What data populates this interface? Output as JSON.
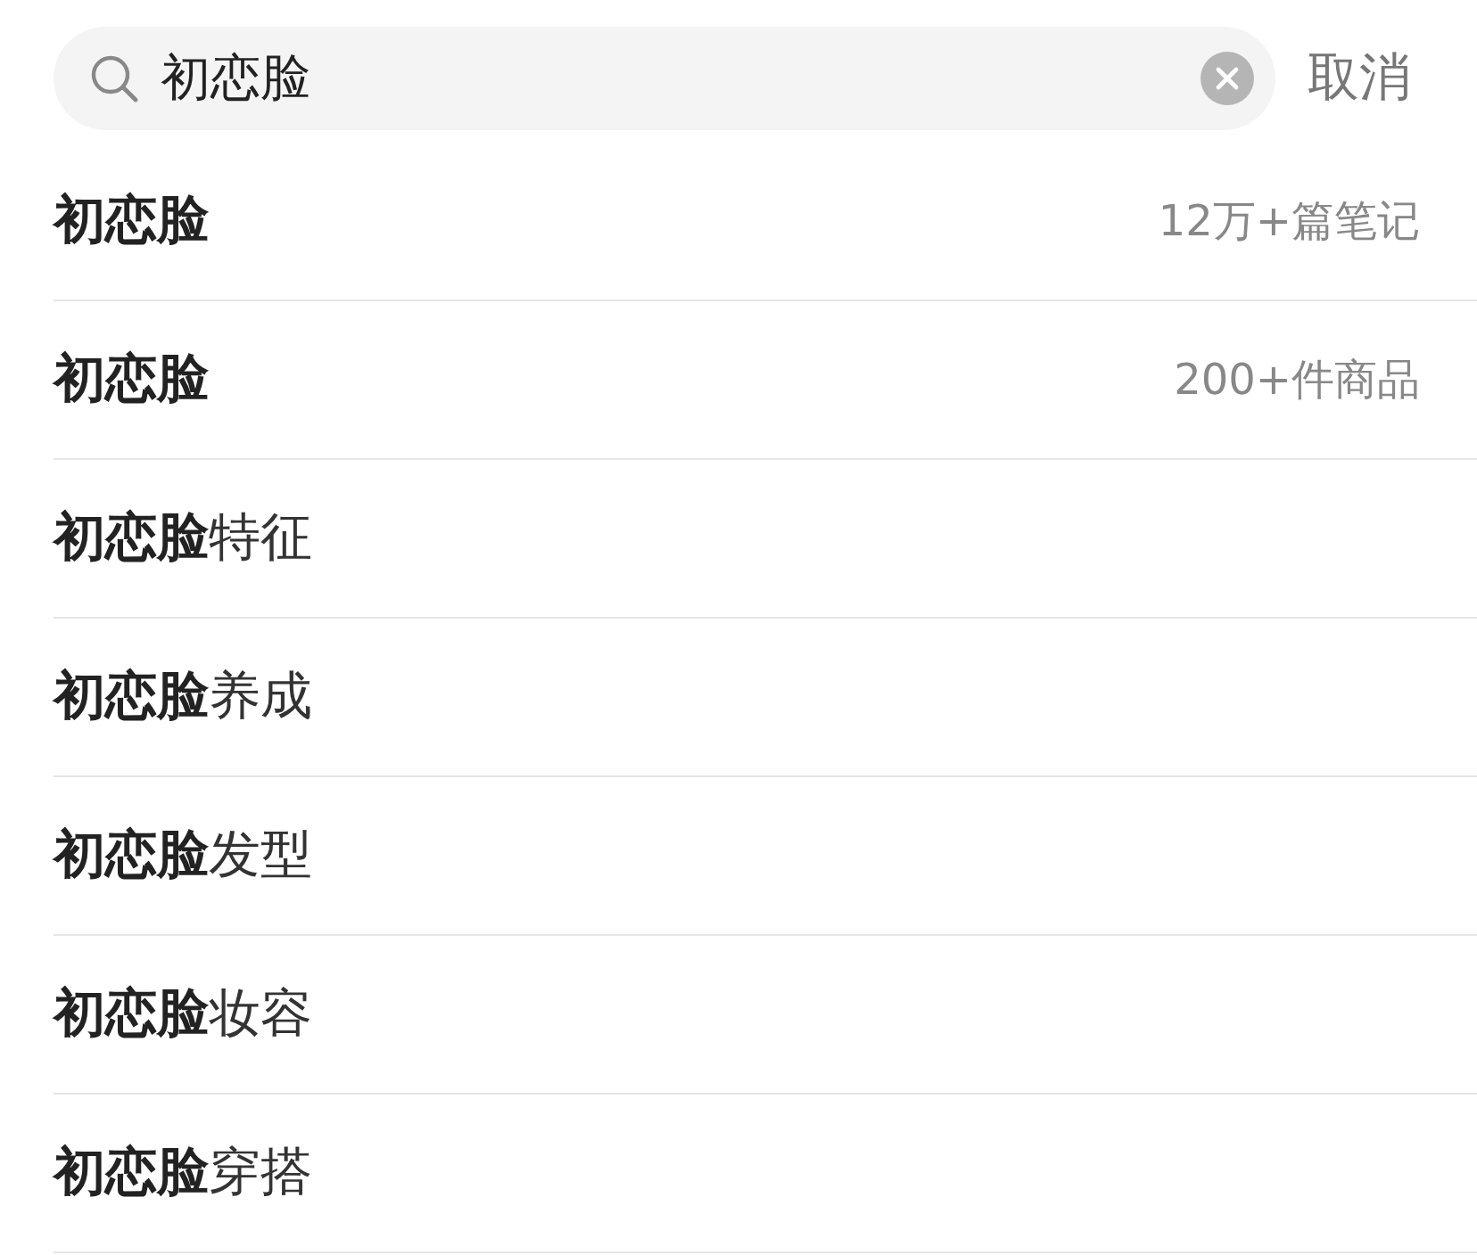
{
  "search": {
    "value": "初恋脸",
    "cancel": "取消"
  },
  "suggestions": [
    {
      "kind": "match",
      "text": "初恋脸",
      "count": "12万+篇笔记"
    },
    {
      "kind": "match",
      "text": "初恋脸",
      "count": "200+件商品"
    },
    {
      "kind": "completion",
      "text": "**初恋脸**特征"
    },
    {
      "kind": "completion",
      "text": "**初恋脸**养成"
    },
    {
      "kind": "completion",
      "text": "**初恋脸**发型"
    },
    {
      "kind": "completion",
      "text": "**初恋脸**妆容"
    },
    {
      "kind": "completion",
      "text": "**初恋脸**穿搭"
    }
  ]
}
